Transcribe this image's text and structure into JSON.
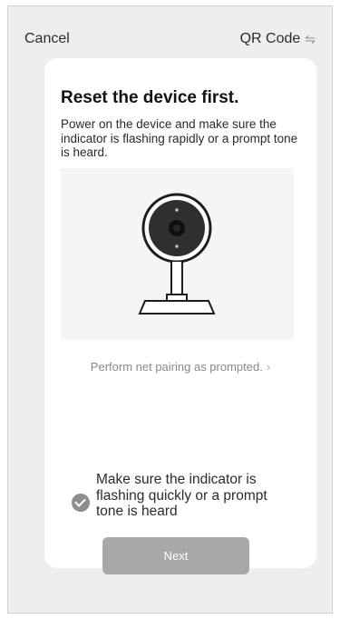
{
  "header": {
    "cancel_label": "Cancel",
    "qr_label": "QR Code",
    "qr_icon": "⇋"
  },
  "card": {
    "title": "Reset the device first.",
    "description": "Power on the device and make sure the indicator is flashing rapidly or a prompt tone is heard.",
    "hint": "Perform net pairing as prompted.",
    "hint_icon": "›",
    "confirm_text": "Make sure the indicator is flashing quickly or a prompt tone is heard",
    "confirm_checked": true,
    "next_label": "Next"
  },
  "colors": {
    "background": "#eeeeee",
    "card": "#ffffff",
    "button": "#a8a8a8",
    "check": "#8e8e8e"
  }
}
